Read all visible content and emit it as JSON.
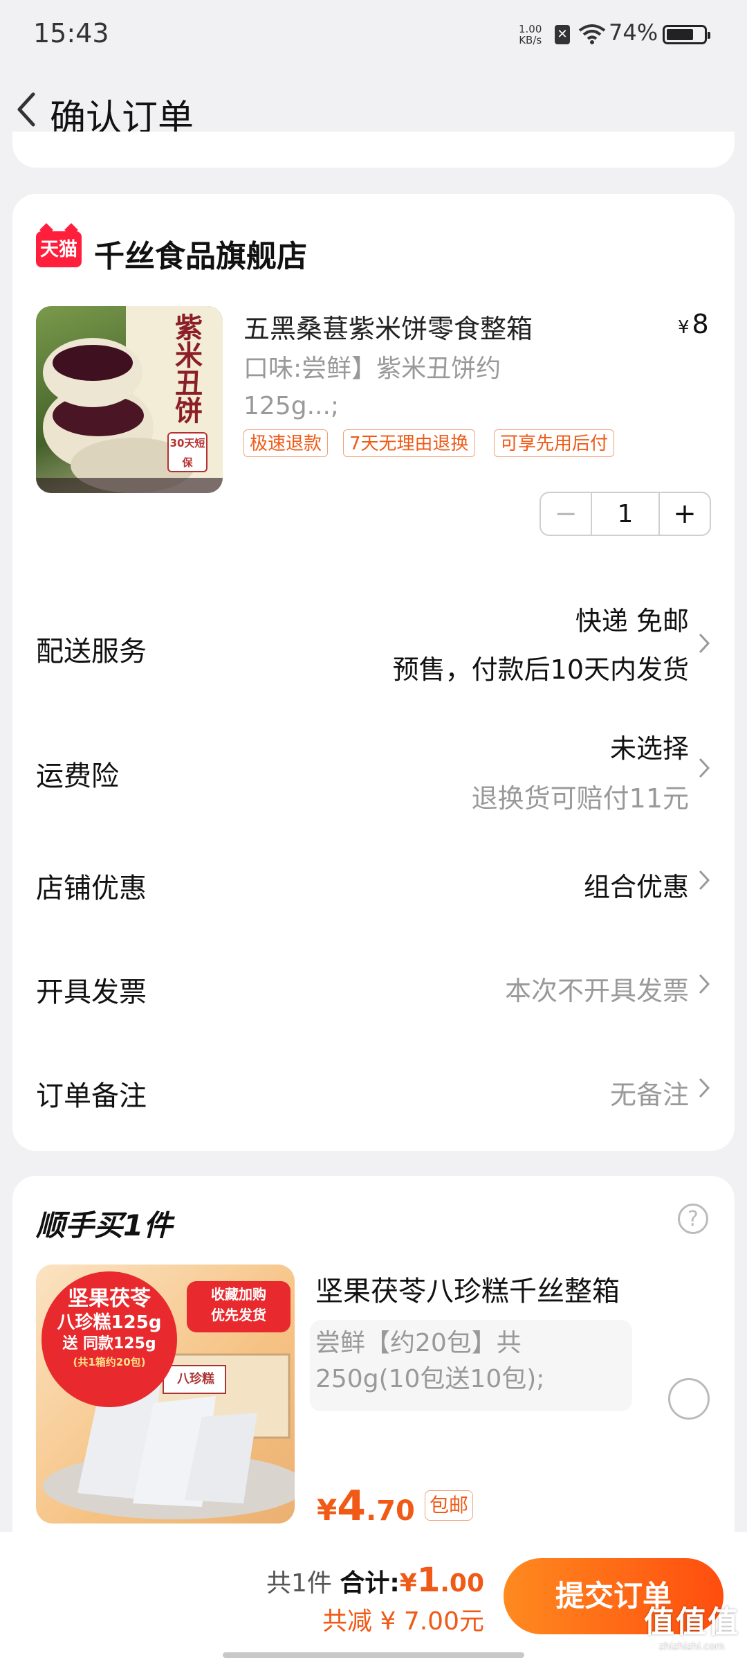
{
  "status_bar": {
    "time": "15:43",
    "net_speed": "1.00",
    "net_unit": "KB/s",
    "battery": "74%",
    "battery_level": 0.74
  },
  "header": {
    "title": "确认订单"
  },
  "store": {
    "logo_text": "天猫",
    "name": "千丝食品旗舰店"
  },
  "product": {
    "title": "五黑桑葚紫米饼零食整箱",
    "price_symbol": "¥",
    "price": "8",
    "spec_line1": "口味:尝鲜】紫米丑饼约",
    "spec_line2": "125g...;",
    "tags": [
      "极速退款",
      "7天无理由退换",
      "可享先用后付"
    ],
    "quantity": "1",
    "image_text": {
      "name": "紫米丑饼",
      "badge": "30天短保"
    }
  },
  "rows": {
    "delivery": {
      "label": "配送服务",
      "line1": "快递 免邮",
      "line2": "预售，付款后10天内发货"
    },
    "insurance": {
      "label": "运费险",
      "line1": "未选择",
      "line2": "退换货可赔付11元"
    },
    "discount": {
      "label": "店铺优惠",
      "value": "组合优惠"
    },
    "invoice": {
      "label": "开具发票",
      "value": "本次不开具发票"
    },
    "note": {
      "label": "订单备注",
      "value": "无备注"
    }
  },
  "addon": {
    "title": "顺手买1件",
    "help": "?",
    "name": "坚果茯苓八珍糕千丝整箱",
    "spec_line1": "尝鲜【约20包】共",
    "spec_line2": "250g(10包送10包);",
    "price_symbol": "¥",
    "price_int": "4",
    "price_dec": ".70",
    "shipping": "包邮",
    "image_text": {
      "line1": "坚果茯苓",
      "line2": "八珍糕125g",
      "line3": "送 同款125g",
      "line4": "(共1箱约20包)",
      "promo1": "收藏加购",
      "promo2": "优先发货",
      "box": "八珍糕"
    }
  },
  "footer": {
    "count": "共1件",
    "total_label": "合计:",
    "total_symbol": "¥",
    "total_int": "1",
    "total_dec": ".00",
    "saved": "共减 ¥ 7.00元",
    "submit": "提交订单"
  },
  "watermark": {
    "big": "值值值",
    "small": "zhizhizhi.com"
  },
  "colors": {
    "accent": "#f05a16",
    "tmall": "#ff1f3d",
    "background": "#f1f1f3"
  }
}
